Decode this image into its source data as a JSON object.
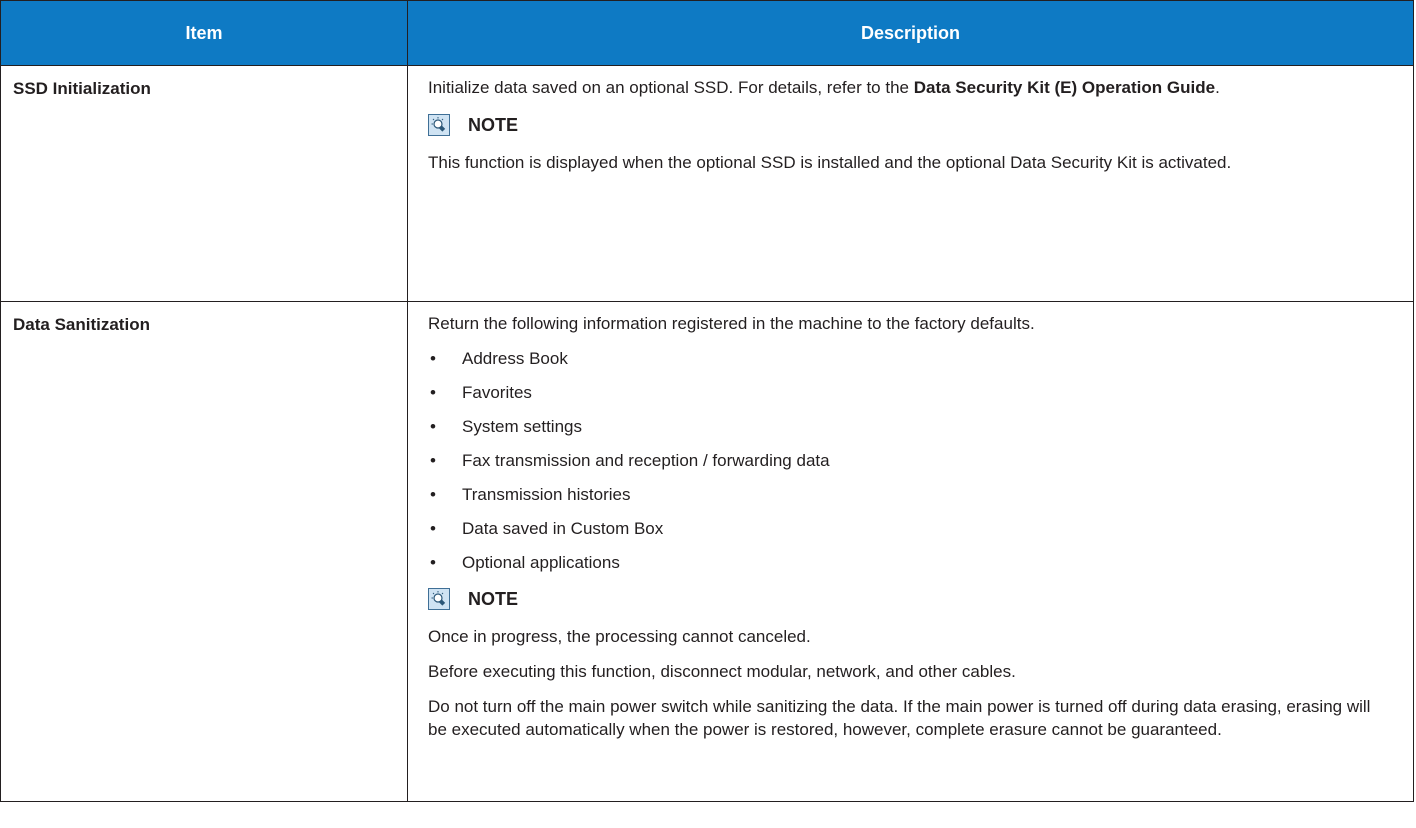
{
  "table": {
    "headers": [
      "Item",
      "Description"
    ],
    "rows": [
      {
        "item": "SSD Initialization",
        "desc_before": "Initialize data saved on an optional SSD. For details, refer to the ",
        "desc_bold": "Data Security Kit (E) Operation Guide",
        "desc_after": ".",
        "note_label": "NOTE",
        "note_text": "This function is displayed when the optional SSD is installed and the optional Data Security Kit is activated."
      },
      {
        "item": "Data Sanitization",
        "intro": "Return the following information registered in the machine to the factory defaults.",
        "bullet_char": "•",
        "bullets": [
          "Address Book",
          "Favorites",
          "System settings",
          "Fax transmission and reception / forwarding data",
          "Transmission histories",
          "Data saved in Custom Box",
          "Optional applications"
        ],
        "note_label": "NOTE",
        "note_lines": [
          "Once in progress, the processing cannot canceled.",
          "Before executing this function, disconnect modular, network, and other cables.",
          "Do not turn off the main power switch while sanitizing the data. If the main power is turned off during data erasing, erasing will be executed automatically when the power is restored, however, complete erasure cannot be guaranteed."
        ]
      }
    ]
  },
  "colors": {
    "header_bg": "#0e7ac4",
    "header_text": "#ffffff",
    "border": "#231f20",
    "note_icon_bg": "#cfe3f3"
  },
  "icons": {
    "note": "lightbulb-note-icon"
  }
}
